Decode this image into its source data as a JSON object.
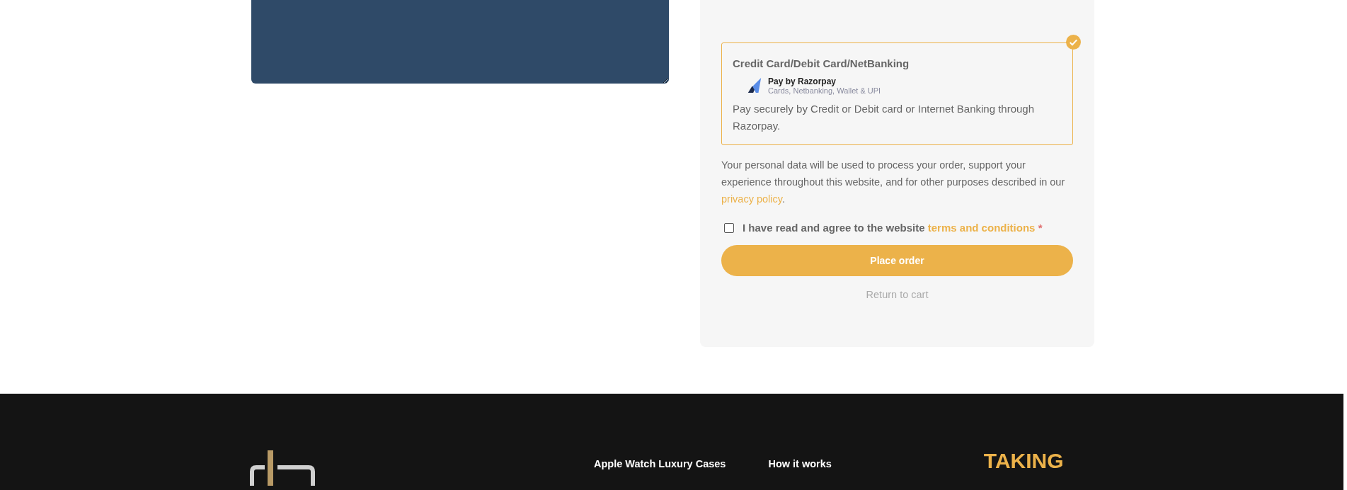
{
  "payment_method": {
    "selected": true,
    "title": "Credit Card/Debit Card/NetBanking",
    "brand_name": "Pay by Razorpay",
    "brand_caption": "Cards, Netbanking, Wallet & UPI",
    "description": "Pay securely by Credit or Debit card or Internet Banking through Razorpay."
  },
  "privacy": {
    "text": "Your personal data will be used to process your order, support your experience throughout this website, and for other purposes described in our",
    "link": "privacy policy",
    "after": "."
  },
  "terms": {
    "checked": false,
    "text": "I have read and agree to the website",
    "link": "terms and conditions",
    "required_mark": "*"
  },
  "place_order_button": "Place order",
  "return_link": "Return to cart",
  "footer": {
    "links": [
      "Apple Watch Luxury Cases",
      "How it works"
    ],
    "heading": "TAKING"
  }
}
